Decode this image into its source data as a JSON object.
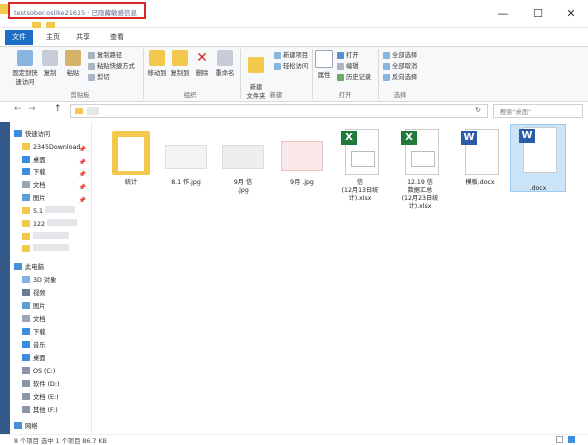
{
  "window": {
    "title": "testsober.oslike21615 · 已隐藏敏感信息",
    "min_label": "—",
    "max_label": "☐",
    "close_label": "✕"
  },
  "tabs": [
    {
      "label": "文件",
      "active": true
    },
    {
      "label": "主页",
      "active": false
    },
    {
      "label": "共享",
      "active": false
    },
    {
      "label": "查看",
      "active": false
    }
  ],
  "ribbon": {
    "clipboard": {
      "pin_label": "固定到快速访问",
      "copy_label": "复制",
      "paste_label": "粘贴",
      "copy_path_label": "复制路径",
      "paste_shortcut_label": "粘贴快捷方式",
      "cut_label": "剪切",
      "group_label": "剪贴板"
    },
    "organize": {
      "move_label": "移动到",
      "copy_to_label": "复制到",
      "delete_label": "删除",
      "rename_label": "重命名",
      "group_label": "组织"
    },
    "new": {
      "new_folder_label": "新建\n文件夹",
      "new_item_label": "新建项目",
      "easy_access_label": "轻松访问",
      "group_label": "新建"
    },
    "open": {
      "properties_label": "属性",
      "open_label": "打开",
      "edit_label": "编辑",
      "history_label": "历史记录",
      "group_label": "打开"
    },
    "select": {
      "select_all_label": "全部选择",
      "select_none_label": "全部取消",
      "invert_label": "反向选择",
      "group_label": "选择"
    }
  },
  "address": {
    "back": "←",
    "forward": "→",
    "up": "↑",
    "refresh": "↻",
    "search_placeholder": "搜索\"桌面\""
  },
  "sidebar": {
    "quick_access_label": "快速访问",
    "items": [
      {
        "label": "2345Download",
        "pinned": true
      },
      {
        "label": "桌面",
        "pinned": true
      },
      {
        "label": "下载",
        "pinned": true
      },
      {
        "label": "文档",
        "pinned": true
      },
      {
        "label": "图片",
        "pinned": true
      },
      {
        "label": "5.1",
        "pinned": false
      },
      {
        "label": "122",
        "pinned": false
      },
      {
        "label": "",
        "pinned": false
      },
      {
        "label": "",
        "pinned": false
      }
    ],
    "this_pc_label": "此电脑",
    "pc_items": [
      {
        "label": "3D 对象"
      },
      {
        "label": "视频"
      },
      {
        "label": "图片"
      },
      {
        "label": "文档"
      },
      {
        "label": "下载"
      },
      {
        "label": "音乐"
      },
      {
        "label": "桌面"
      },
      {
        "label": "OS (C:)"
      },
      {
        "label": "软件 (D:)"
      },
      {
        "label": "文档 (E:)"
      },
      {
        "label": "其他 (F:)"
      }
    ],
    "network_label": "网络"
  },
  "files": [
    {
      "name": "统计",
      "type": "folder"
    },
    {
      "name": "8.1    作.jpg",
      "type": "image"
    },
    {
      "name": "9月        信\n.jpg",
      "type": "image"
    },
    {
      "name": "9月        .jpg",
      "type": "image"
    },
    {
      "name": "          信\n(12月13日统\n计).xlsx",
      "type": "xlsx"
    },
    {
      "name": "12.19        信\n数据汇总\n(12月23日统\n计).xlsx",
      "type": "xlsx"
    },
    {
      "name": "        模板.docx",
      "type": "docx"
    },
    {
      "name": "         \n.docx",
      "type": "docx",
      "selected": true
    }
  ],
  "status": {
    "text": "8 个项目    选中 1 个项目  86.7 KB"
  },
  "colors": {
    "accent": "#1c6fc4",
    "excel": "#1f7a3c",
    "word": "#2b5aa8",
    "folder": "#f2c94c",
    "title_highlight": "#d62a2a"
  }
}
